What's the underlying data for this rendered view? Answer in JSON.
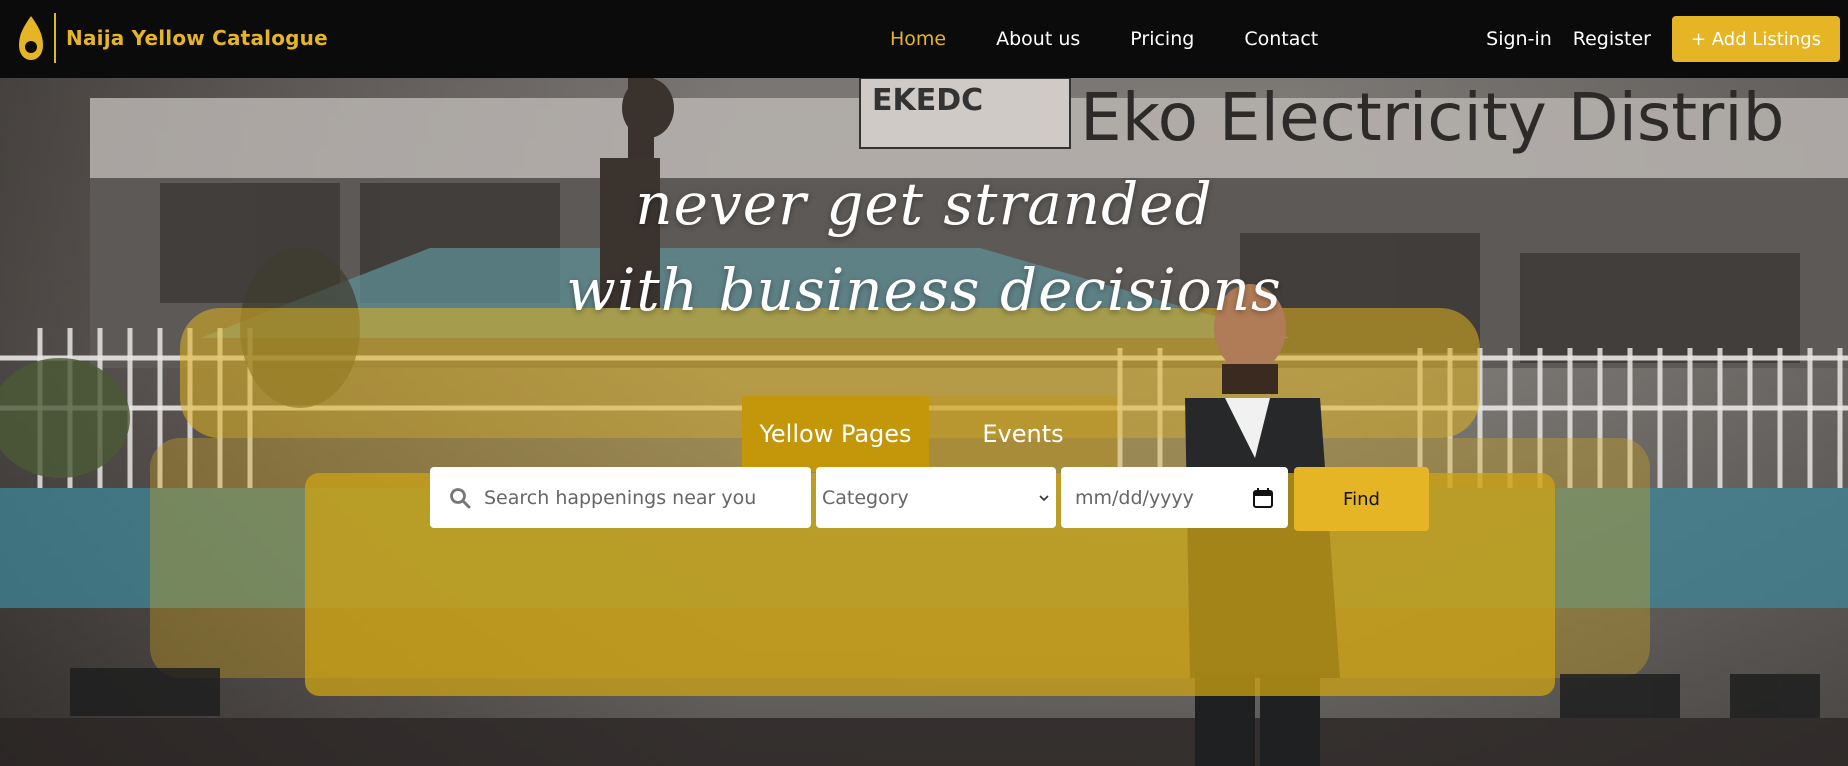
{
  "brand": {
    "name": "Naija Yellow Catalogue",
    "accent": "#e5b526",
    "icon": "location-pin-icon"
  },
  "nav": {
    "links": [
      {
        "label": "Home",
        "active": true
      },
      {
        "label": "About us",
        "active": false
      },
      {
        "label": "Pricing",
        "active": false
      },
      {
        "label": "Contact",
        "active": false
      }
    ],
    "signin": "Sign-in",
    "register": "Register",
    "add_listing": "+ Add Listings"
  },
  "hero": {
    "background_sign": "Eko Electricity Distrib",
    "background_logo_text": "EKEDC",
    "tagline_line1": "never get stranded",
    "tagline_line2": "with business decisions"
  },
  "tabs": [
    {
      "label": "Yellow Pages",
      "active": true
    },
    {
      "label": "Events",
      "active": false
    }
  ],
  "search": {
    "placeholder": "Search happenings near you",
    "category_selected": "Category",
    "date_placeholder": "mm/dd/yyyy",
    "find_label": "Find"
  }
}
